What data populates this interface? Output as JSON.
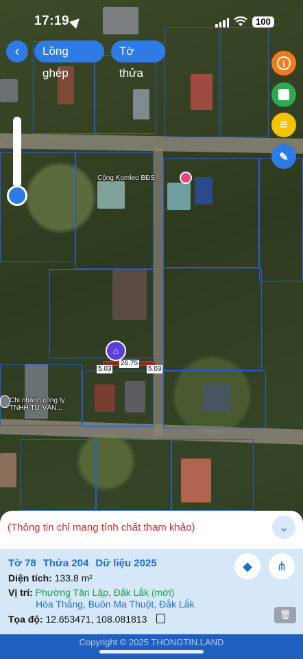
{
  "status_bar": {
    "time": "17:19",
    "battery": "100"
  },
  "top_bar": {
    "back_icon": "chevron-left-icon",
    "overlay_label": "Lồng ghép",
    "parcel_label": "Tờ thửa"
  },
  "side_buttons": [
    {
      "name": "info-icon",
      "glyph": "i",
      "color": "#f07b1b"
    },
    {
      "name": "save-icon",
      "glyph": "■",
      "color": "#2fa84f"
    },
    {
      "name": "list-icon",
      "glyph": "≡",
      "color": "#f5c400"
    },
    {
      "name": "measure-icon",
      "glyph": "✎",
      "color": "#2f7be6"
    }
  ],
  "zoom_slider": {
    "level": 0.15
  },
  "map": {
    "poi_label": "Cộng Komleo BĐS",
    "company_label_line1": "Chi nhánh công ty",
    "company_label_line2": "TNHH TƯ VẤN...",
    "dimension_left": "5.03",
    "dimension_top": "26.75",
    "dimension_right": "5.03"
  },
  "panel": {
    "disclaimer": "(Thông tin chỉ mang tính chất tham khảo)",
    "to": "Tờ 78",
    "thua": "Thửa 204",
    "du_lieu": "Dữ liệu 2025",
    "area_label": "Diện tích:",
    "area_value": "133.8 m²",
    "location_label": "Vị trí:",
    "location_new": "Phường Tân Lập, Đắk Lắk (mới)",
    "location_old": "Hòa Thắng, Buôn Ma Thuột, Đắk Lắk",
    "coord_label": "Tọa độ:",
    "coord_value": "12.653471, 108.081813"
  },
  "footer": {
    "copyright": "Copyright © 2025 THONGTIN.LAND"
  }
}
